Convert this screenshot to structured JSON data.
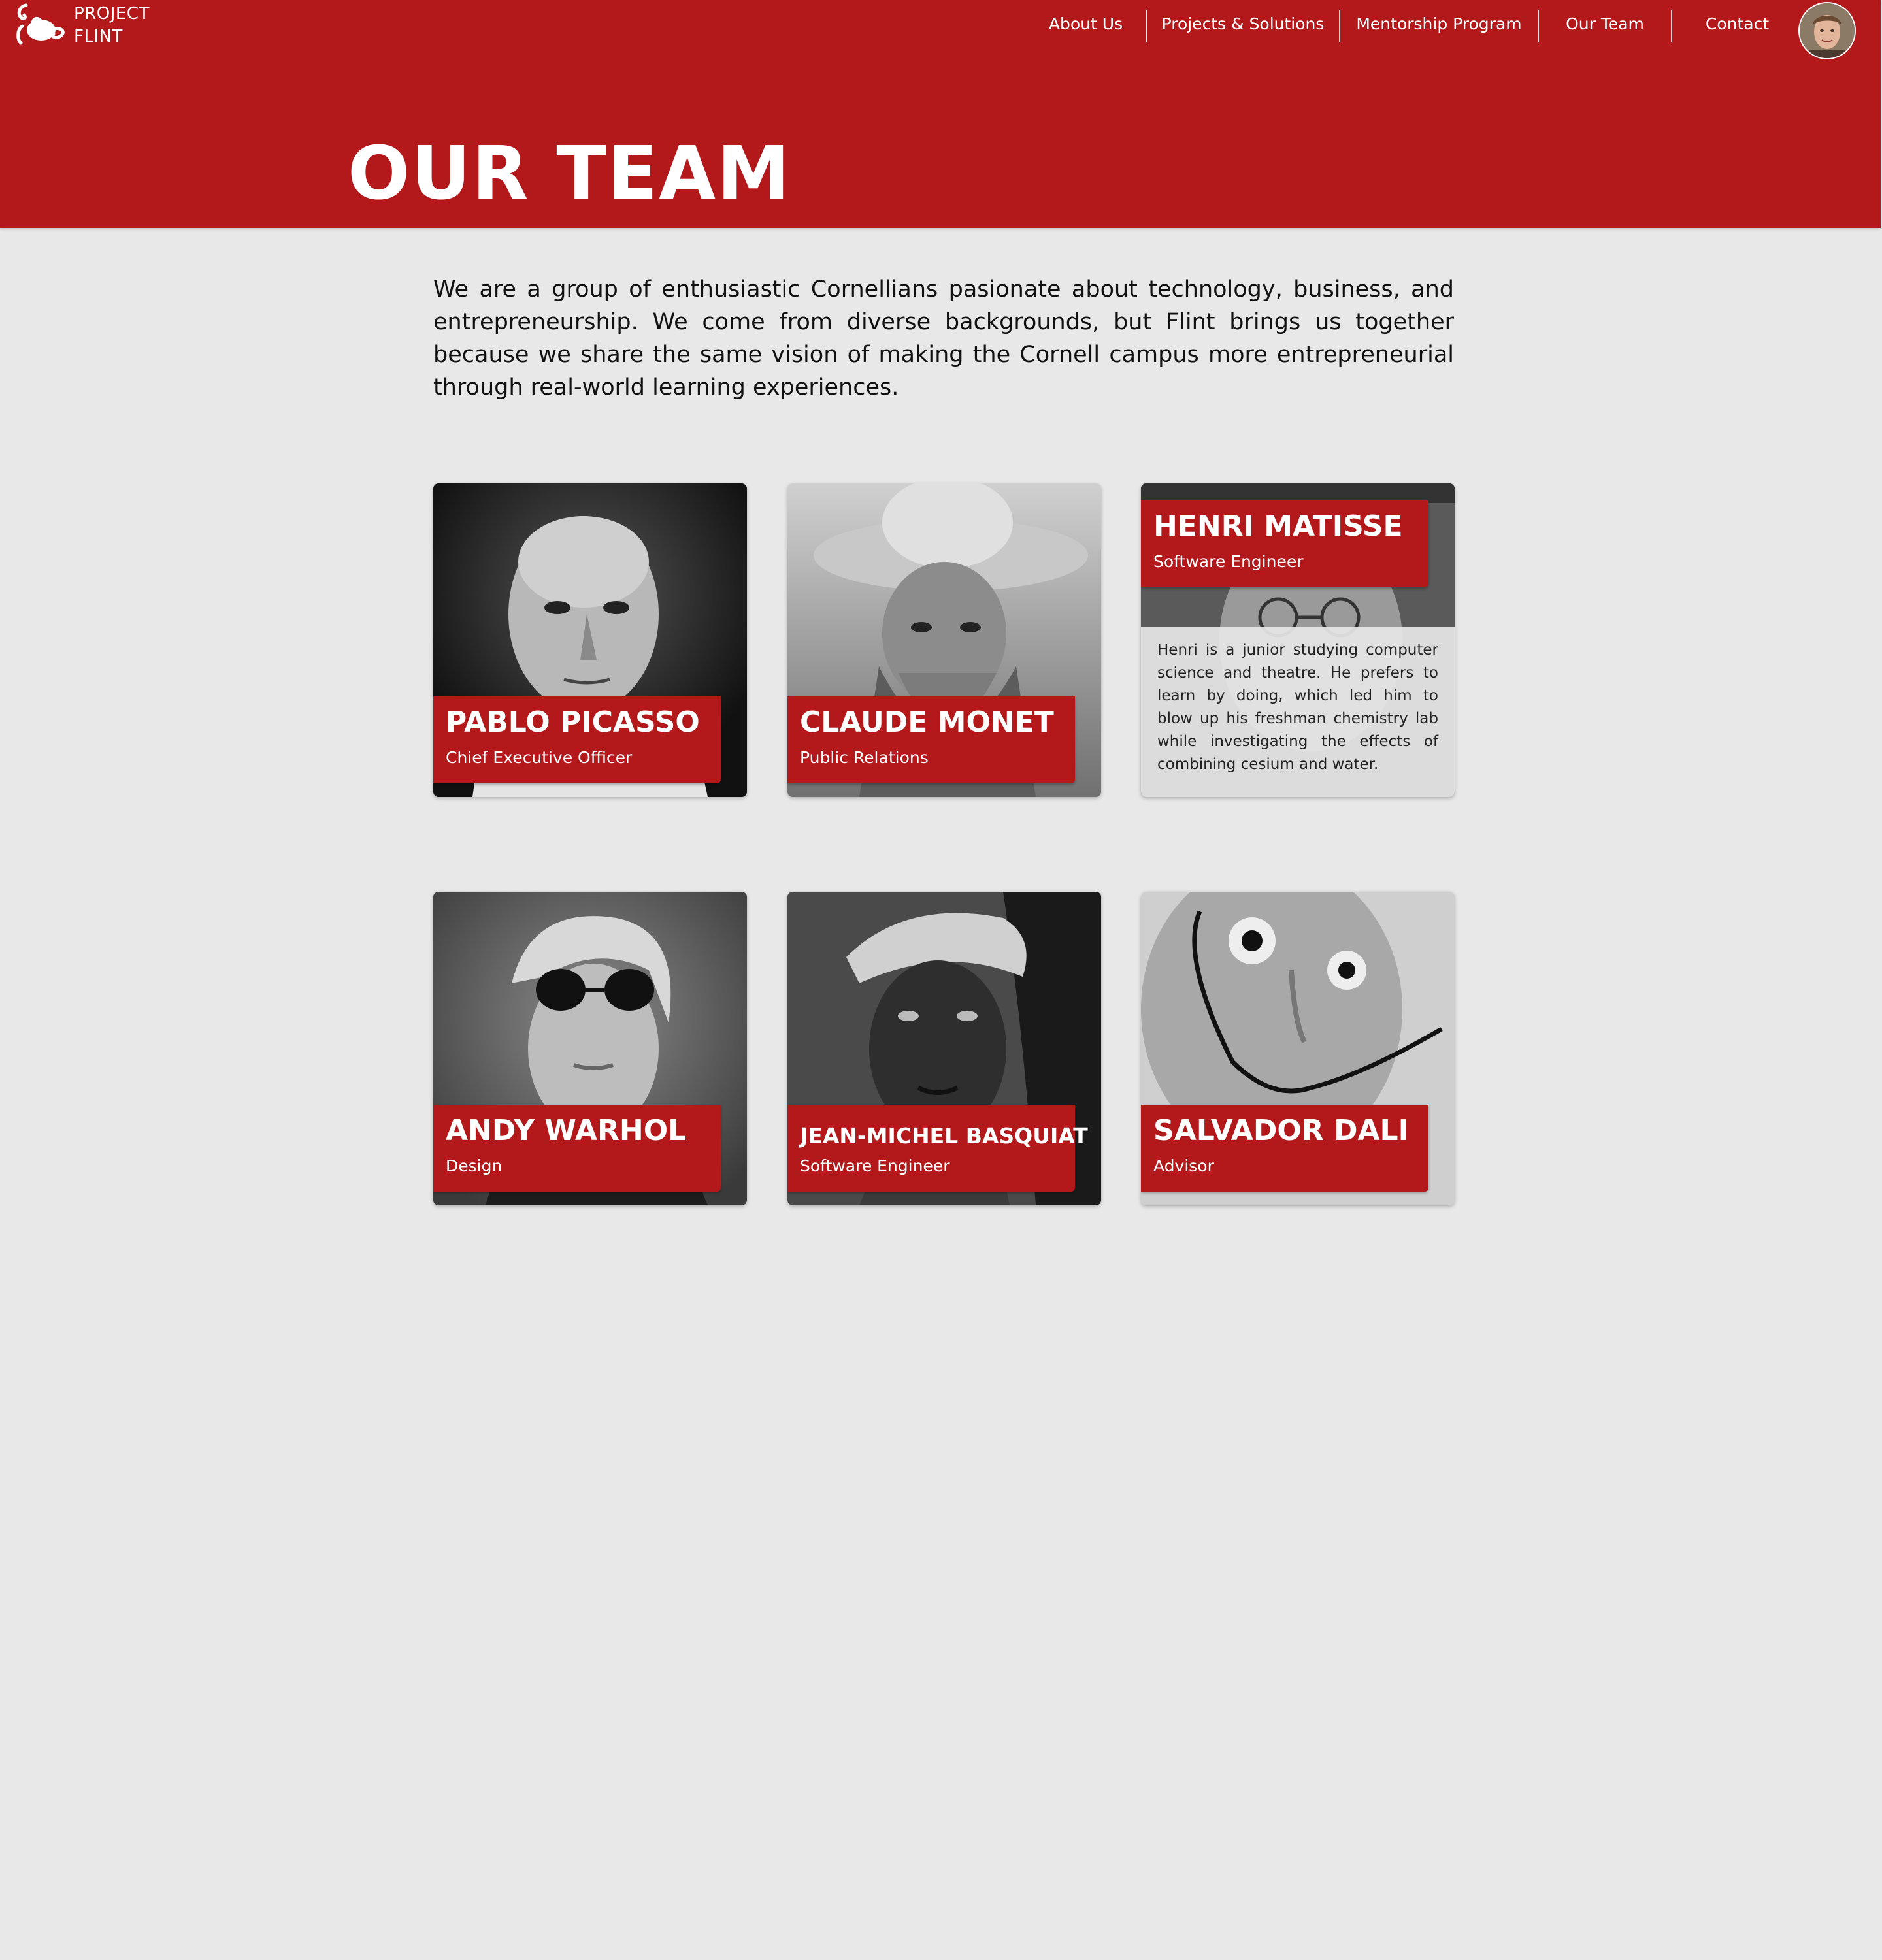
{
  "brand": {
    "line1": "PROJECT",
    "line2": "FLINT"
  },
  "nav": {
    "items": [
      {
        "label": "About Us"
      },
      {
        "label": "Projects & Solutions"
      },
      {
        "label": "Mentorship Program"
      },
      {
        "label": "Our Team"
      },
      {
        "label": "Contact"
      }
    ]
  },
  "header": {
    "title": "OUR TEAM"
  },
  "intro": {
    "text": "We are a group of enthusiastic Cornellians pasionate about technology, business, and entrepreneurship. We come from diverse backgrounds, but Flint brings us together because we share the  same vision of making the Cornell campus more entrepreneurial through real-world learning experiences."
  },
  "team": [
    {
      "name": "PABLO PICASSO",
      "role": "Chief Executive Officer"
    },
    {
      "name": "CLAUDE MONET",
      "role": "Public Relations"
    },
    {
      "name": "HENRI MATISSE",
      "role": "Software Engineer",
      "bio": "Henri is a junior studying computer science and theatre. He prefers to learn by doing, which led him to blow up his freshman chemistry lab while investigating the effects of combining cesium and water."
    },
    {
      "name": "ANDY WARHOL",
      "role": "Design"
    },
    {
      "name": "JEAN-MICHEL BASQUIAT",
      "role": "Software Engineer"
    },
    {
      "name": "SALVADOR DALI",
      "role": "Advisor"
    }
  ],
  "colors": {
    "brand_red": "#b3191b",
    "background": "#e8e8e8",
    "text_dark": "#111111"
  }
}
